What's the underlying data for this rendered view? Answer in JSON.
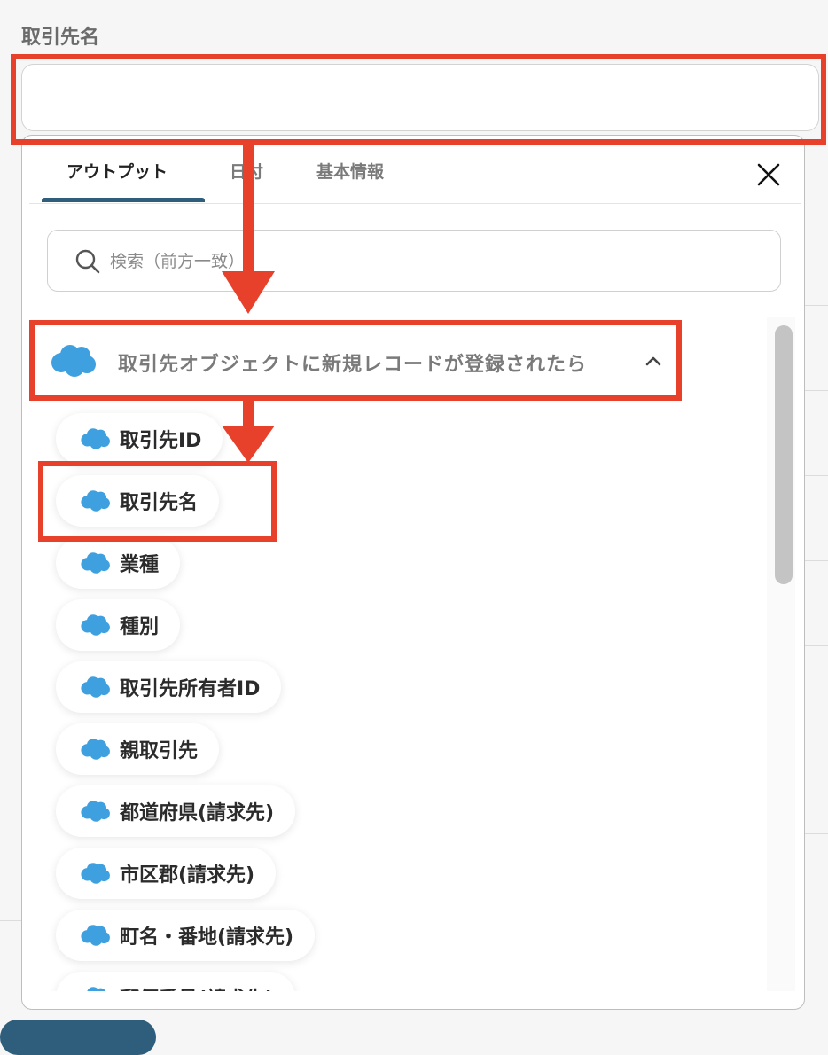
{
  "field": {
    "label": "取引先名",
    "value": "",
    "placeholder": ""
  },
  "tabs": [
    {
      "label": "アウトプット",
      "active": true
    },
    {
      "label": "日付",
      "active": false
    },
    {
      "label": "基本情報",
      "active": false
    }
  ],
  "search": {
    "placeholder": "検索（前方一致）",
    "icon": "search-icon"
  },
  "group": {
    "title": "取引先オブジェクトに新規レコードが登録されたら",
    "icon": "salesforce-cloud-icon",
    "expanded": true
  },
  "items": [
    {
      "label": "取引先ID"
    },
    {
      "label": "取引先名"
    },
    {
      "label": "業種"
    },
    {
      "label": "種別"
    },
    {
      "label": "取引先所有者ID"
    },
    {
      "label": "親取引先"
    },
    {
      "label": "都道府県(請求先)"
    },
    {
      "label": "市区郡(請求先)"
    },
    {
      "label": "町名・番地(請求先)"
    },
    {
      "label": "郵便番号(請求先)"
    }
  ],
  "colors": {
    "accent": "#2e5e7c",
    "annotation": "#e8412b",
    "cloud": "#3fa0e0"
  }
}
